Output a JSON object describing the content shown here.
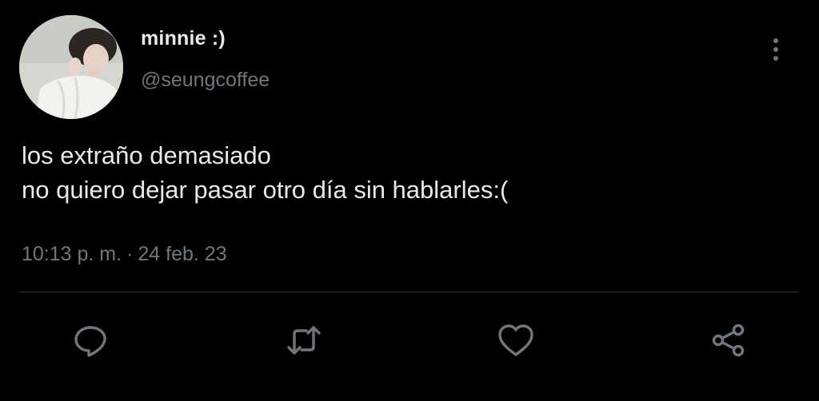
{
  "tweet": {
    "author": {
      "display_name": "minnie :)",
      "handle": "@seungcoffee",
      "avatar_icon": "user-avatar-photo"
    },
    "text_lines": [
      "los extraño demasiado",
      "no quiero dejar pasar otro día sin hablarles:("
    ],
    "time": "10:13 p. m.",
    "separator": "·",
    "date": "24 feb. 23",
    "actions": [
      {
        "name": "reply",
        "icon": "reply-icon"
      },
      {
        "name": "retweet",
        "icon": "retweet-icon"
      },
      {
        "name": "like",
        "icon": "heart-icon"
      },
      {
        "name": "share",
        "icon": "share-icon"
      }
    ],
    "more_icon": "more-vertical-icon"
  },
  "colors": {
    "background": "#000000",
    "primary_text": "#e7e9ea",
    "secondary_text": "#71767b",
    "divider": "#2f3336"
  }
}
